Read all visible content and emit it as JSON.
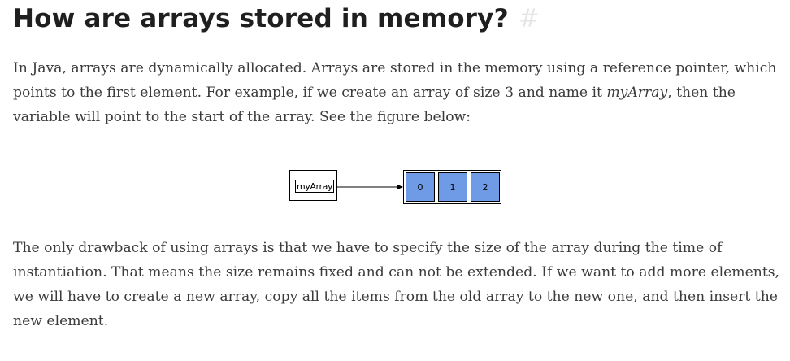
{
  "heading": {
    "title": "How are arrays stored in memory?",
    "anchor": "#"
  },
  "intro": {
    "part1": "In Java, arrays are dynamically allocated. Arrays are stored in the memory using a reference pointer, which points to the first element. For example, if we create an array of size 3 and name it ",
    "emphasis": "myArray",
    "part2": ", then the variable will point to the start of the array. See the figure below:"
  },
  "figure": {
    "variable_label": "myArray",
    "cells": [
      "0",
      "1",
      "2"
    ],
    "cell_color": "#6f9be6"
  },
  "closing": "The only drawback of using arrays is that we have to specify the size of the array during the time of instantiation. That means the size remains fixed and can not be extended. If we want to add more elements, we will have to create a new array, copy all the items from the old array to the new one, and then insert the new element."
}
